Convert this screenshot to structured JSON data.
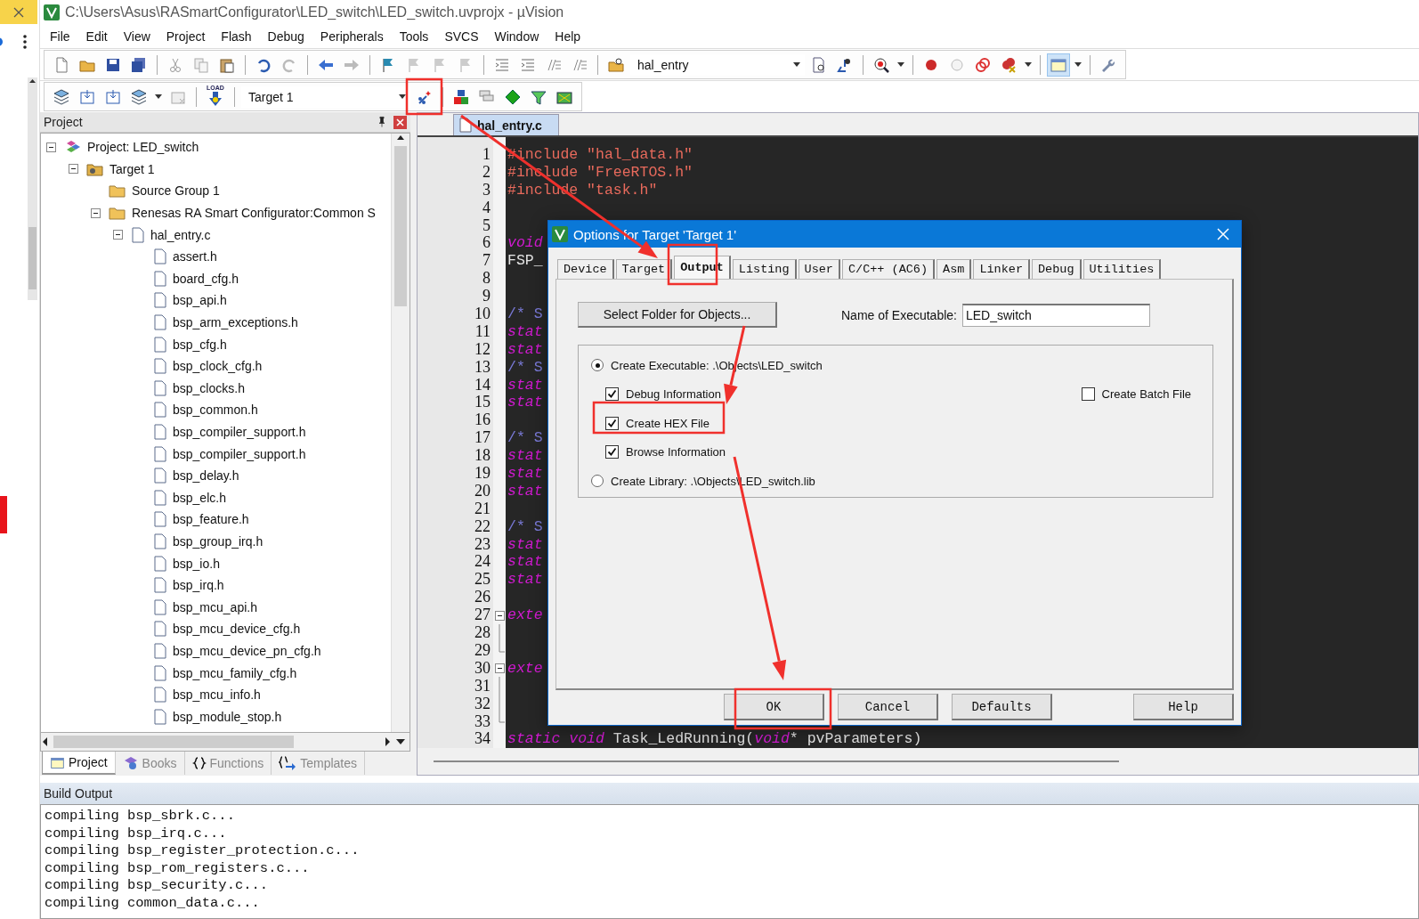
{
  "window": {
    "title": "C:\\Users\\Asus\\RASmartConfigurator\\LED_switch\\LED_switch.uvprojx - µVision"
  },
  "menu": [
    "File",
    "Edit",
    "View",
    "Project",
    "Flash",
    "Debug",
    "Peripherals",
    "Tools",
    "SVCS",
    "Window",
    "Help"
  ],
  "toolbar": {
    "find_combo": "hal_entry",
    "load_label": "LOAD",
    "target_combo": "Target 1"
  },
  "project_pane": {
    "title": "Project",
    "tree": [
      {
        "label": "Project: LED_switch",
        "kind": "project",
        "expanded": true,
        "children": [
          {
            "label": "Target 1",
            "kind": "target",
            "expanded": true,
            "children": [
              {
                "label": "Source Group 1",
                "kind": "group"
              },
              {
                "label": "Renesas RA Smart Configurator:Common S",
                "kind": "group",
                "expanded": true,
                "children": [
                  {
                    "label": "hal_entry.c",
                    "kind": "file",
                    "expanded": true,
                    "children": [
                      {
                        "label": "assert.h",
                        "kind": "file"
                      },
                      {
                        "label": "board_cfg.h",
                        "kind": "file"
                      },
                      {
                        "label": "bsp_api.h",
                        "kind": "file"
                      },
                      {
                        "label": "bsp_arm_exceptions.h",
                        "kind": "file"
                      },
                      {
                        "label": "bsp_cfg.h",
                        "kind": "file"
                      },
                      {
                        "label": "bsp_clock_cfg.h",
                        "kind": "file"
                      },
                      {
                        "label": "bsp_clocks.h",
                        "kind": "file"
                      },
                      {
                        "label": "bsp_common.h",
                        "kind": "file"
                      },
                      {
                        "label": "bsp_compiler_support.h",
                        "kind": "file"
                      },
                      {
                        "label": "bsp_compiler_support.h",
                        "kind": "file"
                      },
                      {
                        "label": "bsp_delay.h",
                        "kind": "file"
                      },
                      {
                        "label": "bsp_elc.h",
                        "kind": "file"
                      },
                      {
                        "label": "bsp_feature.h",
                        "kind": "file"
                      },
                      {
                        "label": "bsp_group_irq.h",
                        "kind": "file"
                      },
                      {
                        "label": "bsp_io.h",
                        "kind": "file"
                      },
                      {
                        "label": "bsp_irq.h",
                        "kind": "file"
                      },
                      {
                        "label": "bsp_mcu_api.h",
                        "kind": "file"
                      },
                      {
                        "label": "bsp_mcu_device_cfg.h",
                        "kind": "file"
                      },
                      {
                        "label": "bsp_mcu_device_pn_cfg.h",
                        "kind": "file"
                      },
                      {
                        "label": "bsp_mcu_family_cfg.h",
                        "kind": "file"
                      },
                      {
                        "label": "bsp_mcu_info.h",
                        "kind": "file"
                      },
                      {
                        "label": "bsp_module_stop.h",
                        "kind": "file"
                      }
                    ]
                  }
                ]
              }
            ]
          }
        ]
      }
    ],
    "tabs": [
      {
        "label": "Project",
        "kind": "project",
        "selected": true
      },
      {
        "label": "Books",
        "kind": "books",
        "selected": false
      },
      {
        "label": "Functions",
        "kind": "functions",
        "selected": false
      },
      {
        "label": "Templates",
        "kind": "templates",
        "selected": false
      }
    ]
  },
  "editor": {
    "tabs": [
      {
        "label": "hal_entry.c",
        "selected": true
      }
    ],
    "lines": [
      {
        "number": "1",
        "segments": [
          {
            "kind": "include",
            "text": "#include \"hal_data.h\""
          }
        ]
      },
      {
        "number": "2",
        "segments": [
          {
            "kind": "include",
            "text": "#include \"FreeRTOS.h\""
          }
        ]
      },
      {
        "number": "3",
        "segments": [
          {
            "kind": "include",
            "text": "#include \"task.h\""
          }
        ]
      },
      {
        "number": "4",
        "kind": "plain"
      },
      {
        "number": "5",
        "kind": "plain"
      },
      {
        "number": "6",
        "segments": [
          {
            "kind": "keyword",
            "text": "void"
          }
        ]
      },
      {
        "number": "7",
        "segments": [
          {
            "kind": "plain",
            "text": "FSP_"
          }
        ]
      },
      {
        "number": "8",
        "kind": "plain"
      },
      {
        "number": "9",
        "kind": "plain"
      },
      {
        "number": "10",
        "segments": [
          {
            "kind": "comment",
            "text": "/* S"
          }
        ]
      },
      {
        "number": "11",
        "segments": [
          {
            "kind": "keyword",
            "text": "stat"
          }
        ]
      },
      {
        "number": "12",
        "segments": [
          {
            "kind": "keyword",
            "text": "stat"
          }
        ]
      },
      {
        "number": "13",
        "segments": [
          {
            "kind": "comment",
            "text": "/* S"
          }
        ]
      },
      {
        "number": "14",
        "segments": [
          {
            "kind": "keyword",
            "text": "stat"
          }
        ]
      },
      {
        "number": "15",
        "segments": [
          {
            "kind": "keyword",
            "text": "stat"
          }
        ]
      },
      {
        "number": "16",
        "kind": "plain"
      },
      {
        "number": "17",
        "segments": [
          {
            "kind": "comment",
            "text": "/* S"
          }
        ]
      },
      {
        "number": "18",
        "segments": [
          {
            "kind": "keyword",
            "text": "stat"
          }
        ]
      },
      {
        "number": "19",
        "segments": [
          {
            "kind": "keyword",
            "text": "stat"
          }
        ]
      },
      {
        "number": "20",
        "segments": [
          {
            "kind": "keyword",
            "text": "stat"
          }
        ]
      },
      {
        "number": "21",
        "kind": "plain"
      },
      {
        "number": "22",
        "segments": [
          {
            "kind": "comment",
            "text": "/* S"
          }
        ]
      },
      {
        "number": "23",
        "segments": [
          {
            "kind": "keyword",
            "text": "stat"
          }
        ]
      },
      {
        "number": "24",
        "segments": [
          {
            "kind": "keyword",
            "text": "stat"
          }
        ]
      },
      {
        "number": "25",
        "segments": [
          {
            "kind": "keyword",
            "text": "stat"
          }
        ]
      },
      {
        "number": "26",
        "kind": "plain"
      },
      {
        "number": "27",
        "kind": "fold_start",
        "segments": [
          {
            "kind": "keyword",
            "text": "exte"
          }
        ]
      },
      {
        "number": "28",
        "kind": "fold_inside"
      },
      {
        "number": "29",
        "kind": "fold_end"
      },
      {
        "number": "30",
        "kind": "fold_start",
        "segments": [
          {
            "kind": "keyword",
            "text": "exte"
          }
        ]
      },
      {
        "number": "31",
        "kind": "fold_inside"
      },
      {
        "number": "32",
        "kind": "fold_inside"
      },
      {
        "number": "33",
        "kind": "fold_end"
      },
      {
        "number": "34",
        "segments": [
          {
            "kind": "keyword",
            "text": "static void"
          },
          {
            "kind": "plain",
            "text": " Task_LedRunning("
          },
          {
            "kind": "keyword",
            "text": "void"
          },
          {
            "kind": "plain",
            "text": "* pvParameters)"
          }
        ]
      }
    ]
  },
  "dialog": {
    "title": "Options for Target 'Target 1'",
    "tabs": [
      {
        "label": "Device",
        "selected": false
      },
      {
        "label": "Target",
        "selected": false
      },
      {
        "label": "Output",
        "selected": true
      },
      {
        "label": "Listing",
        "selected": false
      },
      {
        "label": "User",
        "selected": false
      },
      {
        "label": "C/C++ (AC6)",
        "selected": false
      },
      {
        "label": "Asm",
        "selected": false
      },
      {
        "label": "Linker",
        "selected": false
      },
      {
        "label": "Debug",
        "selected": false
      },
      {
        "label": "Utilities",
        "selected": false
      }
    ],
    "folder_button": "Select Folder for Objects...",
    "executable_label": "Name of Executable:",
    "executable_value": "LED_switch",
    "output_options": [
      {
        "kind": "radio",
        "label": "Create Executable:  .\\Objects\\LED_switch",
        "selected": true
      },
      {
        "kind": "checkbox",
        "label": "Debug Information",
        "checked": true
      },
      {
        "kind": "checkbox",
        "label": "Create HEX File",
        "checked": true
      },
      {
        "kind": "checkbox",
        "label": "Browse Information",
        "checked": true
      },
      {
        "kind": "radio",
        "label": "Create Library:  .\\Objects\\LED_switch.lib",
        "selected": false
      }
    ],
    "batch_file": {
      "label": "Create Batch File",
      "checked": false
    },
    "buttons": [
      "OK",
      "Cancel",
      "Defaults",
      "Help"
    ]
  },
  "build_output": {
    "title": "Build Output",
    "lines": [
      "compiling bsp_sbrk.c...",
      "compiling bsp_irq.c...",
      "compiling bsp_register_protection.c...",
      "compiling bsp_rom_registers.c...",
      "compiling bsp_security.c...",
      "compiling common_data.c..."
    ]
  }
}
